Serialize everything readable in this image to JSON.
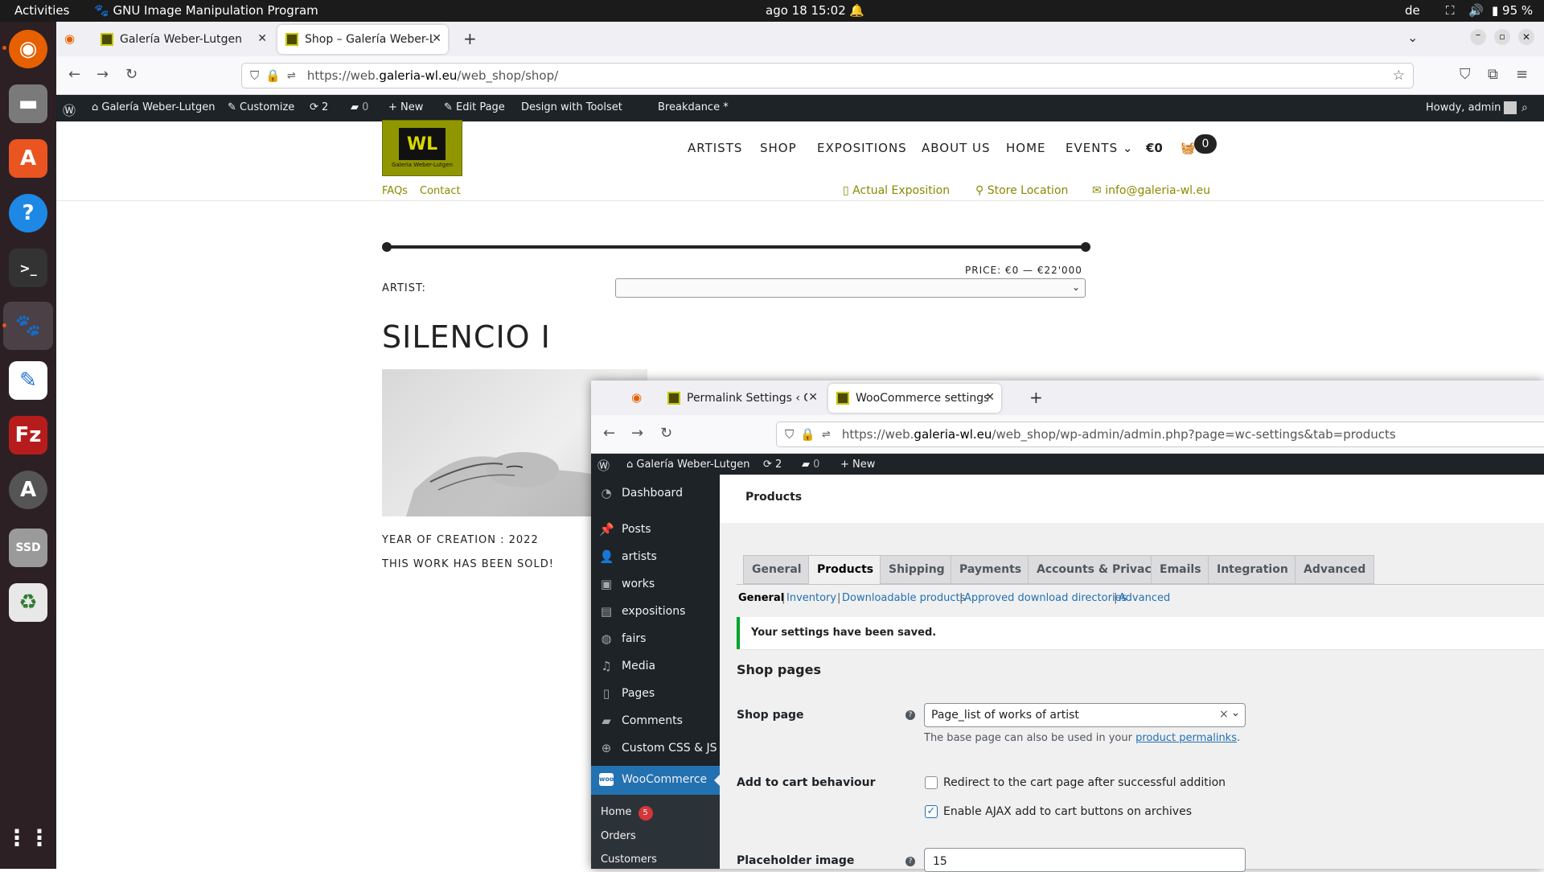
{
  "topbar": {
    "activities": "Activities",
    "app_name": "GNU Image Manipulation Program",
    "clock": "ago 18  15:02",
    "lang": "de",
    "battery": "95 %"
  },
  "browser1": {
    "tabs": [
      {
        "label": "Galería Weber-Lutgen"
      },
      {
        "label": "Shop – Galería Weber-Lutg"
      }
    ],
    "url_prefix": "https://web.",
    "url_domain": "galeria-wl.eu",
    "url_path": "/web_shop/shop/"
  },
  "adminbar1": {
    "site": "Galería Weber-Lutgen",
    "customize": "Customize",
    "updates": "2",
    "comments": "0",
    "new": "New",
    "edit_page": "Edit Page",
    "toolset": "Design with Toolset",
    "breakdance": "Breakdance *",
    "howdy": "Howdy, admin"
  },
  "site": {
    "logo_text": "WL",
    "logo_sub": "Galeria Weber-Lutgen",
    "menu": [
      "ARTISTS",
      "SHOP",
      "EXPOSITIONS",
      "ABOUT US",
      "HOME",
      "EVENTS"
    ],
    "cart_total": "€0",
    "cart_count": "0",
    "faqs": "FAQs",
    "contact": "Contact",
    "actual_exposition": "Actual Exposition",
    "store_location": "Store Location",
    "email": "info@galeria-wl.eu",
    "price_label": "PRICE: €0 — €22'000",
    "artist_label": "ARTIST:",
    "work_title": "SILENCIO I",
    "year": "YEAR OF CREATION : 2022",
    "sold": "THIS WORK HAS BEEN SOLD!"
  },
  "browser2": {
    "tabs": [
      {
        "label": "Permalink Settings ‹ Gale"
      },
      {
        "label": "WooCommerce settings"
      }
    ],
    "url_prefix": "https://web.",
    "url_domain": "galeria-wl.eu",
    "url_path": "/web_shop/wp-admin/admin.php?page=wc-settings&tab=products"
  },
  "adminbar2": {
    "site": "Galería Weber-Lutgen",
    "updates": "2",
    "comments": "0",
    "new": "New"
  },
  "sidebar": {
    "items": [
      {
        "label": "Dashboard",
        "icon": "dashboard-icon"
      },
      {
        "label": "Posts",
        "icon": "pin-icon"
      },
      {
        "label": "artists",
        "icon": "user-icon"
      },
      {
        "label": "works",
        "icon": "image-icon"
      },
      {
        "label": "expositions",
        "icon": "gallery-icon"
      },
      {
        "label": "fairs",
        "icon": "globe-icon"
      },
      {
        "label": "Media",
        "icon": "media-icon"
      },
      {
        "label": "Pages",
        "icon": "page-icon"
      },
      {
        "label": "Comments",
        "icon": "comment-icon"
      },
      {
        "label": "Custom CSS & JS",
        "icon": "plus-circle-icon"
      }
    ],
    "woocommerce": "WooCommerce",
    "sub": [
      {
        "label": "Home",
        "badge": "5"
      },
      {
        "label": "Orders"
      },
      {
        "label": "Customers"
      }
    ]
  },
  "wc": {
    "page_title": "Products",
    "tabs": [
      "General",
      "Products",
      "Shipping",
      "Payments",
      "Accounts & Privacy",
      "Emails",
      "Integration",
      "Advanced"
    ],
    "subtabs": [
      "General",
      "Inventory",
      "Downloadable products",
      "Approved download directories",
      "Advanced"
    ],
    "notice": "Your settings have been saved.",
    "section": "Shop pages",
    "shop_page_label": "Shop page",
    "shop_page_value": "Page_list of works of artist",
    "shop_page_desc": "The base page can also be used in your ",
    "shop_page_link": "product permalinks",
    "cart_label": "Add to cart behaviour",
    "redirect_label": "Redirect to the cart page after successful addition",
    "ajax_label": "Enable AJAX add to cart buttons on archives",
    "placeholder_label": "Placeholder image",
    "placeholder_value": "15"
  }
}
